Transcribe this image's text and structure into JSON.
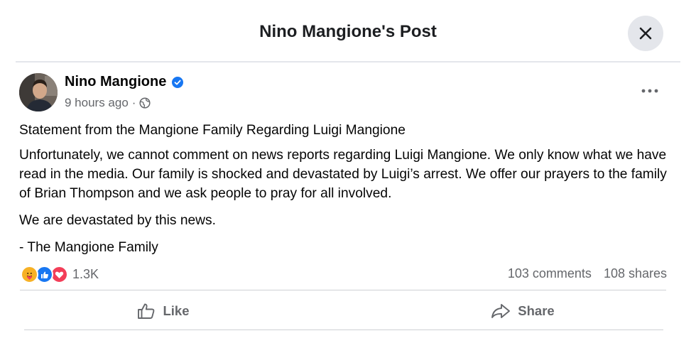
{
  "header": {
    "title": "Nino Mangione's Post",
    "close_icon": "close-icon"
  },
  "post": {
    "author": "Nino Mangione",
    "verified": true,
    "timestamp": "9 hours ago",
    "separator": "·",
    "audience_icon": "globe-icon",
    "more_label": "•••",
    "paragraphs": [
      "Statement from the Mangione Family Regarding Luigi Mangione",
      "Unfortunately, we cannot comment on news reports regarding Luigi Mangione.  We only know what we have read in the media.  Our family is shocked and devastated by Luigi’s arrest.  We offer our prayers to the family of Brian Thompson and we ask people to pray for all involved.",
      "We are devastated by this news.",
      "- The Mangione Family"
    ]
  },
  "engagement": {
    "reaction_icons": [
      "care-icon",
      "like-icon",
      "love-icon"
    ],
    "reaction_count": "1.3K",
    "comments": "103 comments",
    "shares": "108 shares"
  },
  "actions": {
    "like_label": "Like",
    "share_label": "Share"
  },
  "colors": {
    "verified": "#1877f2",
    "like_reaction": "#1877f2",
    "love_reaction": "#f33e58",
    "care_reaction": "#f7b125",
    "secondary_text": "#65676b",
    "close_button_bg": "#e4e6eb"
  }
}
